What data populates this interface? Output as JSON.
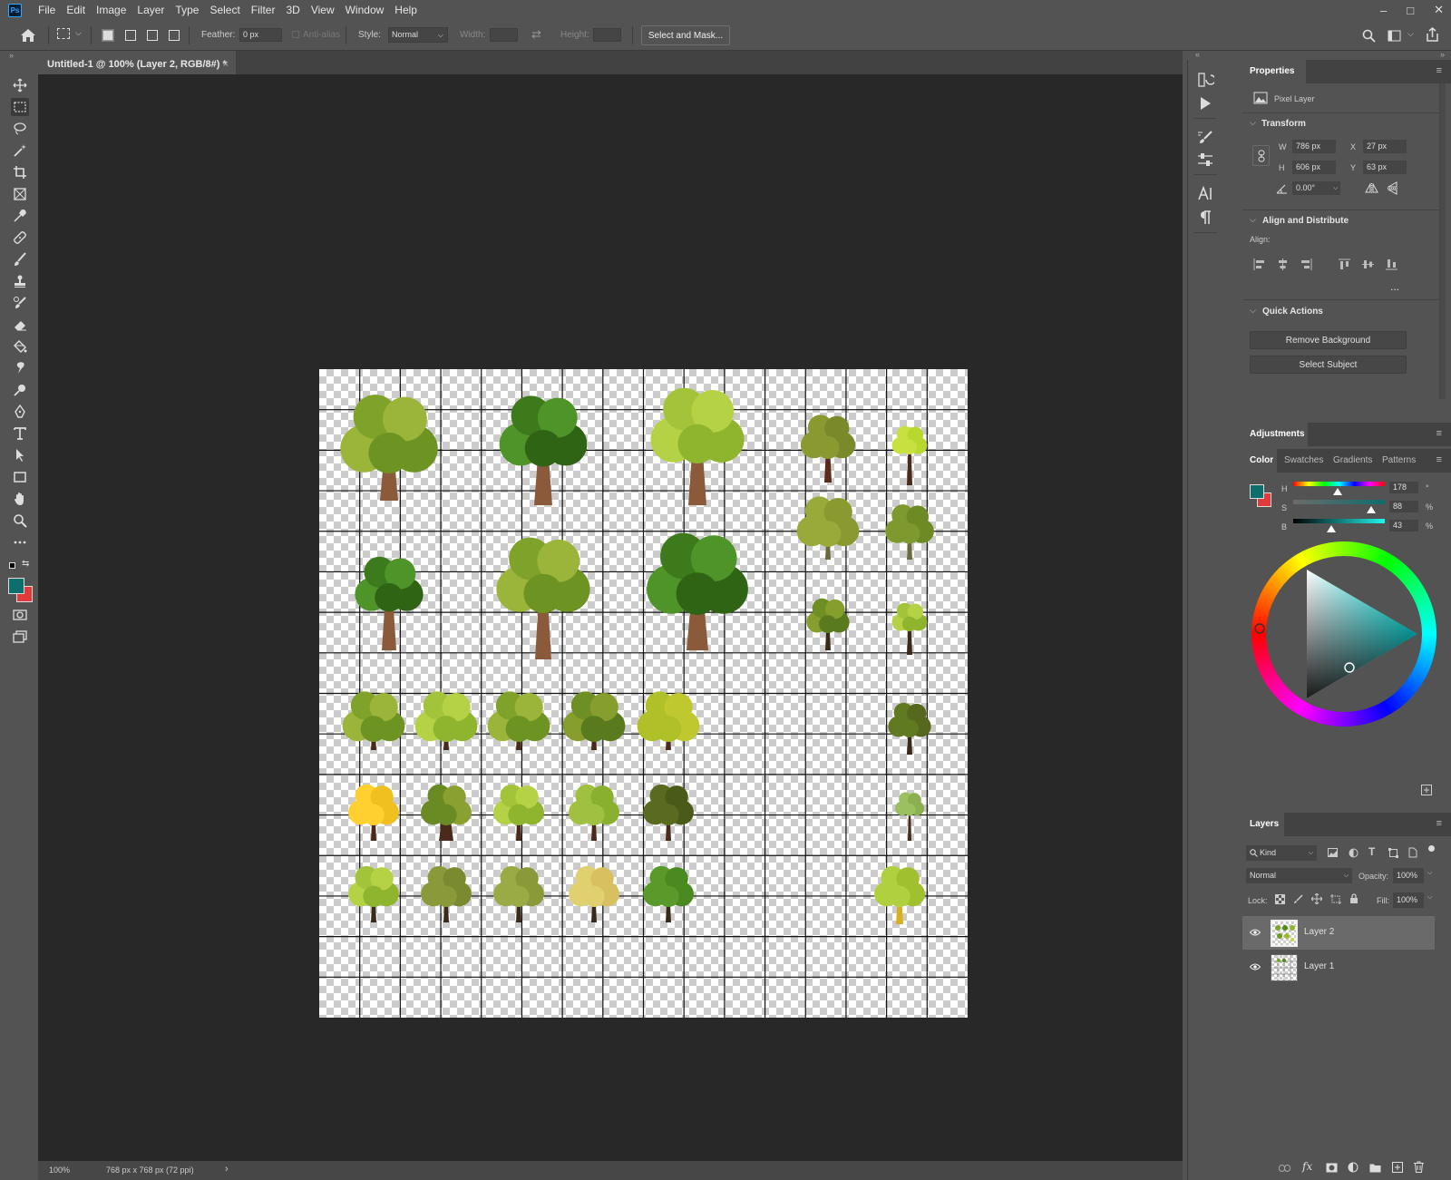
{
  "menubar": {
    "logo": "Ps",
    "items": [
      "File",
      "Edit",
      "Image",
      "Layer",
      "Type",
      "Select",
      "Filter",
      "3D",
      "View",
      "Window",
      "Help"
    ]
  },
  "options": {
    "feather_label": "Feather:",
    "feather_value": "0 px",
    "antialias_label": "Anti-alias",
    "style_label": "Style:",
    "style_value": "Normal",
    "width_label": "Width:",
    "height_label": "Height:",
    "select_mask_label": "Select and Mask..."
  },
  "document": {
    "tab_title": "Untitled-1 @ 100% (Layer 2, RGB/8#) *",
    "tab_close": "×"
  },
  "status": {
    "zoom": "100%",
    "doc_info": "768 px x 768 px (72 ppi)",
    "arrow": "›"
  },
  "properties": {
    "tab": "Properties",
    "layer_type": "Pixel Layer",
    "transform_title": "Transform",
    "w_label": "W",
    "w_value": "786 px",
    "h_label": "H",
    "h_value": "606 px",
    "x_label": "X",
    "x_value": "27 px",
    "y_label": "Y",
    "y_value": "63 px",
    "angle_value": "0.00°",
    "align_title": "Align and Distribute",
    "align_label": "Align:",
    "more": "...",
    "quick_actions_title": "Quick Actions",
    "remove_bg": "Remove Background",
    "select_subject": "Select Subject"
  },
  "adjustments": {
    "tab": "Adjustments"
  },
  "color_panel": {
    "tabs": [
      "Color",
      "Swatches",
      "Gradients",
      "Patterns"
    ],
    "h_label": "H",
    "h_value": "178",
    "h_unit": "°",
    "s_label": "S",
    "s_value": "88",
    "s_unit": "%",
    "b_label": "B",
    "b_value": "43",
    "b_unit": "%",
    "foreground": "#0d6e6b",
    "background": "#e03a3a"
  },
  "layers": {
    "tab": "Layers",
    "kind_label": "Kind",
    "blend_mode": "Normal",
    "opacity_label": "Opacity:",
    "opacity_value": "100%",
    "lock_label": "Lock:",
    "fill_label": "Fill:",
    "fill_value": "100%",
    "items": [
      {
        "name": "Layer 2",
        "selected": true
      },
      {
        "name": "Layer 1",
        "selected": false
      }
    ]
  },
  "colors": {
    "foreground": "#0d6e6b",
    "background": "#e03a3a"
  }
}
